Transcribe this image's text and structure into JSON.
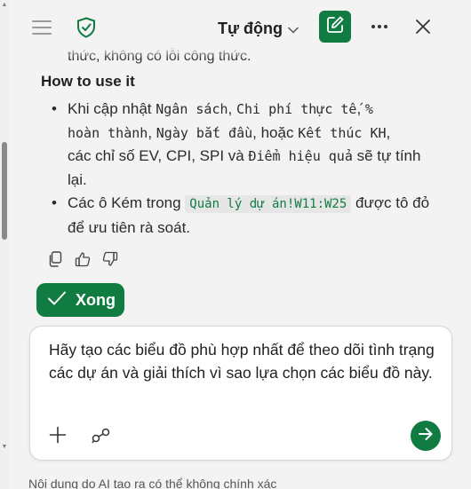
{
  "header": {
    "mode_label": "Tự động",
    "icons": [
      "menu-icon",
      "shield-check-icon",
      "chevron-down-icon",
      "new-chat-icon",
      "more-icon",
      "close-icon"
    ],
    "accent_color": "#107c41"
  },
  "message": {
    "cut_off_line": "thức, không có lỗi công thức.",
    "section_title": "How to use it",
    "bullet1": {
      "prefix": "Khi cập nhật ",
      "budget": "Ngân sách",
      "comma1": ", ",
      "actual_cost": "Chi phí thực tế",
      "comma2": ", ",
      "percent": "%",
      "completed": "hoàn thành",
      "comma3": ", ",
      "start_date": "Ngày bắt đầu",
      "or_text": ", hoặc ",
      "end_plan": "Kết thúc KH",
      "comma4": ",",
      "middle": "các chỉ số EV, CPI, SPI và ",
      "score": "Điểm hiệu quả",
      "suffix": " sẽ tự tính lại."
    },
    "bullet2": {
      "prefix": "Các ô Kém trong ",
      "range": "Quản lý dự án!W11:W25",
      "suffix": " được tô đỏ để ưu tiên rà soát."
    }
  },
  "feedback": {
    "icons": [
      "copy-icon",
      "thumbs-up-icon",
      "thumbs-down-icon"
    ]
  },
  "done_button": {
    "label": "Xong"
  },
  "composer": {
    "value": "Hãy tạo các biểu đồ phù hợp nhất để theo dõi tình trạng các dự án và giải thích vì sao lựa chọn các biểu đồ này.",
    "icons": [
      "plus-icon",
      "prompts-icon",
      "send-icon"
    ]
  },
  "disclaimer": "Nội dung do AI tạo ra có thể không chính xác"
}
